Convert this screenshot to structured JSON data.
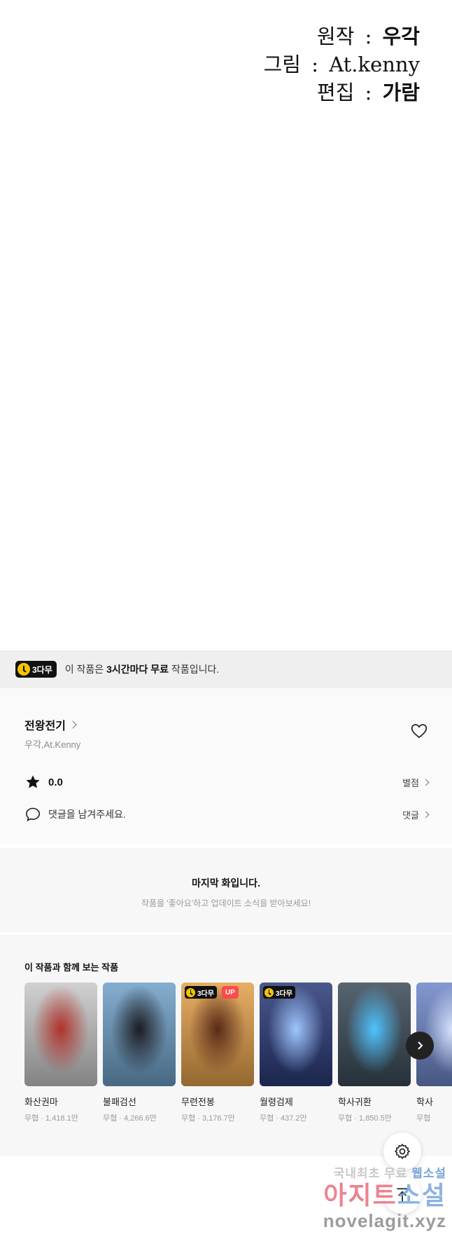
{
  "credits": [
    {
      "role": "원작",
      "sep": ":",
      "name": "우각"
    },
    {
      "role": "그림",
      "sep": ":",
      "name": "At.kenny"
    },
    {
      "role": "편집",
      "sep": ":",
      "name": "가람"
    }
  ],
  "free_banner": {
    "badge": "3다무",
    "text_before": "이 작품은 ",
    "text_bold": "3시간마다 무료",
    "text_after": " 작품입니다."
  },
  "series": {
    "title": "전왕전기",
    "authors": "우각,At.Kenny",
    "rating": "0.0",
    "rating_link": "별점",
    "comment_prompt": "댓글을 남겨주세요.",
    "comment_link": "댓글"
  },
  "last_episode": {
    "title": "마지막 화입니다.",
    "subtitle": "작품을 '좋아요'하고 업데이트 소식을 받아보세요!"
  },
  "recommendations": {
    "title": "이 작품과 함께 보는 작품",
    "items": [
      {
        "name": "화산권마",
        "meta": "무협 · 1,418.1만",
        "badge": "",
        "up": "",
        "art_bg": "#c9c9c9",
        "art_accent": "#b0322a"
      },
      {
        "name": "불패검선",
        "meta": "무협 · 4,266.6만",
        "badge": "",
        "up": "",
        "art_bg": "#6fa0c8",
        "art_accent": "#1c1c22"
      },
      {
        "name": "무련전봉",
        "meta": "무협 · 3,176.7만",
        "badge": "3다무",
        "up": "UP",
        "art_bg": "#e3a04a",
        "art_accent": "#5a2a18"
      },
      {
        "name": "월령검제",
        "meta": "무협 · 437.2만",
        "badge": "3다무",
        "up": "",
        "art_bg": "#2a3a78",
        "art_accent": "#9fc6ff"
      },
      {
        "name": "학사귀환",
        "meta": "무협 · 1,850.5만",
        "badge": "",
        "up": "",
        "art_bg": "#3a4a58",
        "art_accent": "#4fc3ff"
      },
      {
        "name": "학사",
        "meta": "무협",
        "badge": "",
        "up": "",
        "art_bg": "#6e86c8",
        "art_accent": "#d8e4ff"
      }
    ]
  },
  "watermark": {
    "line1_a": "국내최초 무료 ",
    "line1_b": "웹소설",
    "line2_a": "아지트",
    "line2_b": "소설",
    "line3": "novelagit.xyz"
  },
  "colors": {
    "badge_bg": "#111111",
    "clock_yellow": "#f5c400",
    "up_red": "#ff4a4a"
  },
  "icons": [
    "heart-icon",
    "star-icon",
    "comment-icon",
    "chevron-right-icon",
    "settings-icon",
    "arrow-up-icon",
    "clock-icon"
  ]
}
